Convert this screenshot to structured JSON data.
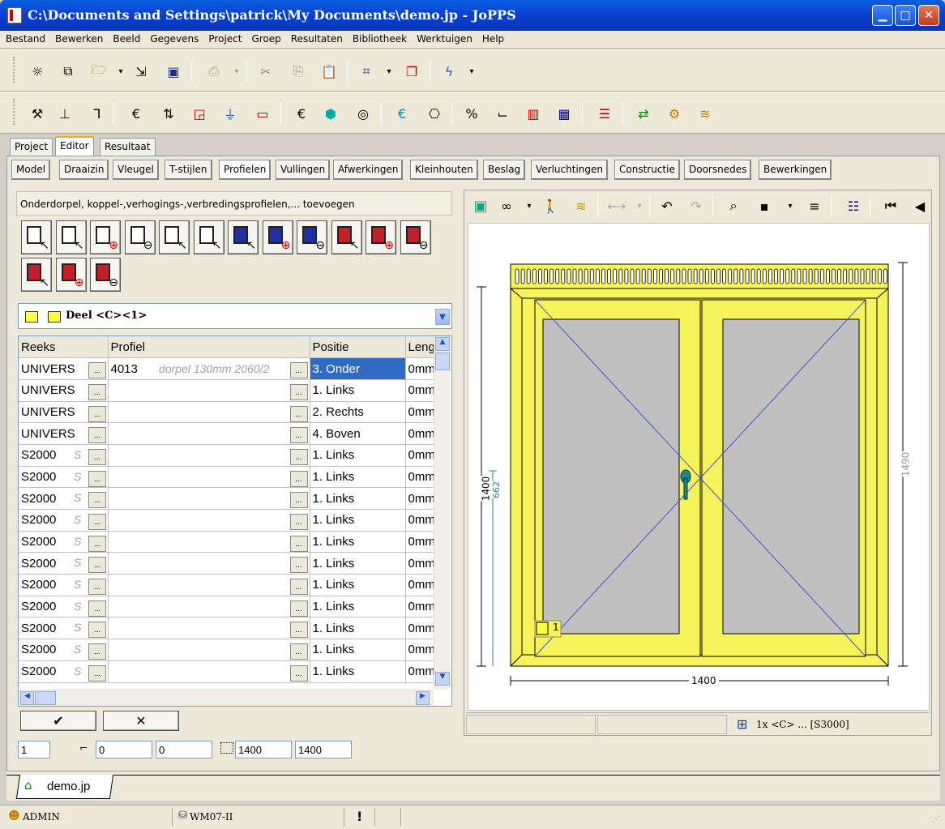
{
  "window": {
    "title": "C:\\Documents and Settings\\patrick\\My Documents\\demo.jp - JoPPS"
  },
  "menu": [
    "Bestand",
    "Bewerken",
    "Beeld",
    "Gegevens",
    "Project",
    "Groep",
    "Resultaten",
    "Bibliotheek",
    "Werktuigen",
    "Help"
  ],
  "main_tabs": [
    "Project",
    "Editor",
    "Resultaat"
  ],
  "editor_tabs": [
    "Model",
    "Draaizin",
    "Vleugel",
    "T-stijlen",
    "Profielen",
    "Vullingen",
    "Afwerkingen",
    "Kleinhouten",
    "Beslag",
    "Verluchtingen",
    "Constructie",
    "Doorsnedes",
    "Bewerkingen"
  ],
  "left_panel": {
    "header": "Onderdorpel, koppel-,verhogings-,verbredingsprofielen,... toevoegen",
    "part_selector": "Deel <C><1>",
    "columns": [
      "Reeks",
      "Profiel",
      "Positie",
      "Lengte"
    ],
    "rows": [
      {
        "reeks": "UNIVERS",
        "profiel": "4013",
        "desc": "dorpel 130mm 2060/2",
        "positie": "3. Onder",
        "lengte": "0mm",
        "selected": true
      },
      {
        "reeks": "UNIVERS",
        "profiel": "",
        "desc": "",
        "positie": "1. Links",
        "lengte": "0mm"
      },
      {
        "reeks": "UNIVERS",
        "profiel": "",
        "desc": "",
        "positie": "2. Rechts",
        "lengte": "0mm"
      },
      {
        "reeks": "UNIVERS",
        "profiel": "",
        "desc": "",
        "positie": "4. Boven",
        "lengte": "0mm"
      },
      {
        "reeks": "S2000",
        "profiel": "",
        "desc": "",
        "positie": "1. Links",
        "lengte": "0mm"
      },
      {
        "reeks": "S2000",
        "profiel": "",
        "desc": "",
        "positie": "1. Links",
        "lengte": "0mm"
      },
      {
        "reeks": "S2000",
        "profiel": "",
        "desc": "",
        "positie": "1. Links",
        "lengte": "0mm"
      },
      {
        "reeks": "S2000",
        "profiel": "",
        "desc": "",
        "positie": "1. Links",
        "lengte": "0mm"
      },
      {
        "reeks": "S2000",
        "profiel": "",
        "desc": "",
        "positie": "1. Links",
        "lengte": "0mm"
      },
      {
        "reeks": "S2000",
        "profiel": "",
        "desc": "",
        "positie": "1. Links",
        "lengte": "0mm"
      },
      {
        "reeks": "S2000",
        "profiel": "",
        "desc": "",
        "positie": "1. Links",
        "lengte": "0mm"
      },
      {
        "reeks": "S2000",
        "profiel": "",
        "desc": "",
        "positie": "1. Links",
        "lengte": "0mm"
      },
      {
        "reeks": "S2000",
        "profiel": "",
        "desc": "",
        "positie": "1. Links",
        "lengte": "0mm"
      },
      {
        "reeks": "S2000",
        "profiel": "",
        "desc": "",
        "positie": "1. Links",
        "lengte": "0mm"
      },
      {
        "reeks": "S2000",
        "profiel": "",
        "desc": "",
        "positie": "1. Links",
        "lengte": "0mm"
      }
    ],
    "ok_label": "✔",
    "cancel_label": "✕",
    "fields": {
      "index": "1",
      "x": "0",
      "y": "0",
      "width": "1400",
      "height": "1400"
    }
  },
  "drawing": {
    "width_label": "1400",
    "height_left": "1400",
    "height_left_inner": "662",
    "height_right": "1490",
    "part_tag": "1",
    "status_text": "1x <C> ... [S3000]"
  },
  "doc_tab": "demo.jp",
  "status": {
    "user": "ADMIN",
    "db": "WM07-II",
    "flag": "!"
  },
  "colors": {
    "frame_yellow": "#f6f45a",
    "glass": "#c0c0c0",
    "diagonal": "#4455cc",
    "selected_row": "#316ac5"
  }
}
